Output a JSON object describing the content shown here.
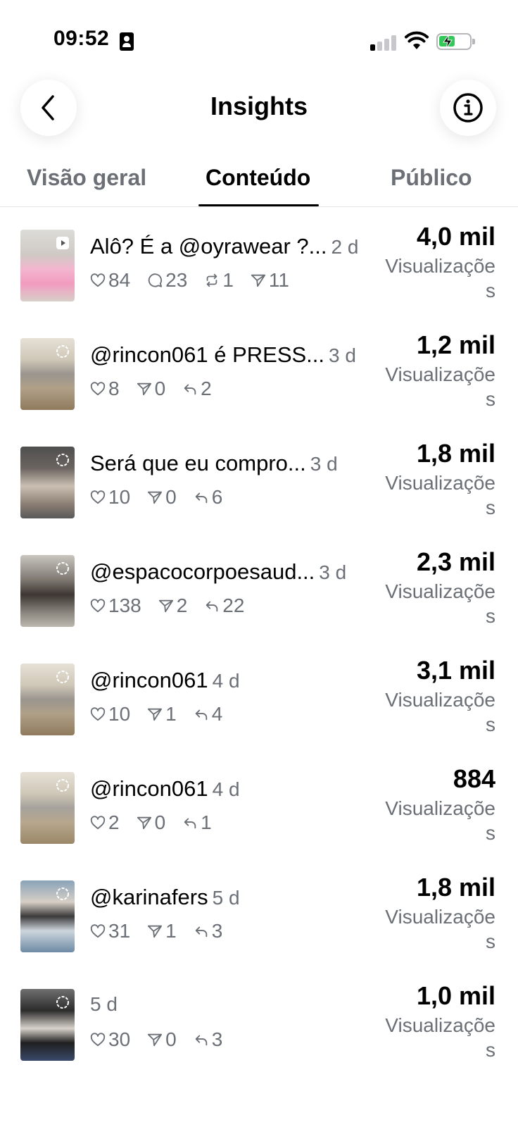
{
  "status_bar": {
    "time": "09:52"
  },
  "header": {
    "title": "Insights"
  },
  "tabs": [
    {
      "label": "Visão geral",
      "active": false
    },
    {
      "label": "Conteúdo",
      "active": true
    },
    {
      "label": "Público",
      "active": false
    }
  ],
  "metric_label": "Visualizações",
  "items": [
    {
      "caption": "Alô? É a @oyrawear ?...",
      "age": "2 d",
      "value": "4,0 mil",
      "stats": [
        {
          "icon": "heart-icon",
          "value": "84"
        },
        {
          "icon": "comment-icon",
          "value": "23"
        },
        {
          "icon": "repost-icon",
          "value": "1"
        },
        {
          "icon": "share-icon",
          "value": "11"
        }
      ]
    },
    {
      "caption": "@rincon061 é PRESS...",
      "age": "3 d",
      "value": "1,2 mil",
      "stats": [
        {
          "icon": "heart-icon",
          "value": "8"
        },
        {
          "icon": "share-icon",
          "value": "0"
        },
        {
          "icon": "reply-icon",
          "value": "2"
        }
      ]
    },
    {
      "caption": "Será que eu compro...",
      "age": "3 d",
      "value": "1,8 mil",
      "stats": [
        {
          "icon": "heart-icon",
          "value": "10"
        },
        {
          "icon": "share-icon",
          "value": "0"
        },
        {
          "icon": "reply-icon",
          "value": "6"
        }
      ]
    },
    {
      "caption": "@espacocorpoesaud...",
      "age": "3 d",
      "value": "2,3 mil",
      "stats": [
        {
          "icon": "heart-icon",
          "value": "138"
        },
        {
          "icon": "share-icon",
          "value": "2"
        },
        {
          "icon": "reply-icon",
          "value": "22"
        }
      ]
    },
    {
      "caption": "@rincon061",
      "age": "4 d",
      "value": "3,1 mil",
      "stats": [
        {
          "icon": "heart-icon",
          "value": "10"
        },
        {
          "icon": "share-icon",
          "value": "1"
        },
        {
          "icon": "reply-icon",
          "value": "4"
        }
      ]
    },
    {
      "caption": "@rincon061",
      "age": "4 d",
      "value": "884",
      "stats": [
        {
          "icon": "heart-icon",
          "value": "2"
        },
        {
          "icon": "share-icon",
          "value": "0"
        },
        {
          "icon": "reply-icon",
          "value": "1"
        }
      ]
    },
    {
      "caption": "@karinafers",
      "age": "5 d",
      "value": "1,8 mil",
      "stats": [
        {
          "icon": "heart-icon",
          "value": "31"
        },
        {
          "icon": "share-icon",
          "value": "1"
        },
        {
          "icon": "reply-icon",
          "value": "3"
        }
      ]
    },
    {
      "caption": "",
      "age": "5 d",
      "value": "1,0 mil",
      "stats": [
        {
          "icon": "heart-icon",
          "value": "30"
        },
        {
          "icon": "share-icon",
          "value": "0"
        },
        {
          "icon": "reply-icon",
          "value": "3"
        }
      ]
    }
  ],
  "colors": {
    "text": "#000000",
    "secondary": "#6b6f76",
    "divider": "#e5e5e5",
    "battery": "#34c759"
  }
}
